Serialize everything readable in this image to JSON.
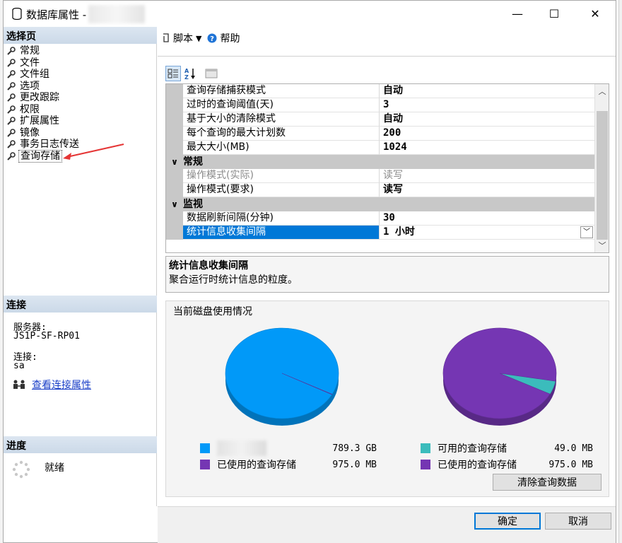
{
  "window": {
    "title": "数据库属性 -",
    "minimize": "—",
    "maximize": "☐",
    "close": "✕"
  },
  "left": {
    "select_page_header": "选择页",
    "pages": [
      "常规",
      "文件",
      "文件组",
      "选项",
      "更改跟踪",
      "权限",
      "扩展属性",
      "镜像",
      "事务日志传送",
      "查询存储"
    ],
    "selected_page": "查询存储",
    "connection_header": "连接",
    "server_label": "服务器:",
    "server_value": "JS1P-SF-RP01",
    "connection_label": "连接:",
    "connection_value": "sa",
    "view_connection_link": "查看连接属性",
    "progress_header": "进度",
    "progress_status": "就绪"
  },
  "toolbar": {
    "script_label": "脚本",
    "help_label": "帮助"
  },
  "grid": {
    "rows_top": [
      {
        "name": "查询存储捕获模式",
        "value": "自动"
      },
      {
        "name": "过时的查询阈值(天)",
        "value": "3"
      },
      {
        "name": "基于大小的清除模式",
        "value": "自动"
      },
      {
        "name": "每个查询的最大计划数",
        "value": "200"
      },
      {
        "name": "最大大小(MB)",
        "value": "1024"
      }
    ],
    "category_general": "常规",
    "rows_general": [
      {
        "name": "操作模式(实际)",
        "value": "读写"
      },
      {
        "name": "操作模式(要求)",
        "value": "读写"
      }
    ],
    "category_monitor": "监视",
    "rows_monitor": [
      {
        "name": "数据刷新间隔(分钟)",
        "value": "30"
      },
      {
        "name": "统计信息收集间隔",
        "value": "1 小时"
      }
    ]
  },
  "description": {
    "title": "统计信息收集间隔",
    "text": "聚合运行时统计信息的粒度。"
  },
  "disk": {
    "title": "当前磁盘使用情况",
    "left_legend": [
      {
        "label": "",
        "value": "789.3 GB",
        "color": "#0199f8"
      },
      {
        "label": "已使用的查询存储",
        "value": "975.0 MB",
        "color": "#7536b3"
      }
    ],
    "right_legend": [
      {
        "label": "可用的查询存储",
        "value": "49.0 MB",
        "color": "#3bbcbc"
      },
      {
        "label": "已使用的查询存储",
        "value": "975.0 MB",
        "color": "#7536b3"
      }
    ],
    "clear_button": "清除查询数据"
  },
  "chart_data": [
    {
      "type": "pie",
      "series": [
        {
          "values": [
            789.3,
            0.95
          ]
        }
      ],
      "categories": [
        "",
        "已使用的查询存储"
      ],
      "units": [
        "GB",
        "GB"
      ]
    },
    {
      "type": "pie",
      "categories": [
        "可用的查询存储",
        "已使用的查询存储"
      ],
      "values": [
        49.0,
        975.0
      ]
    }
  ],
  "footer": {
    "ok": "确定",
    "cancel": "取消"
  }
}
